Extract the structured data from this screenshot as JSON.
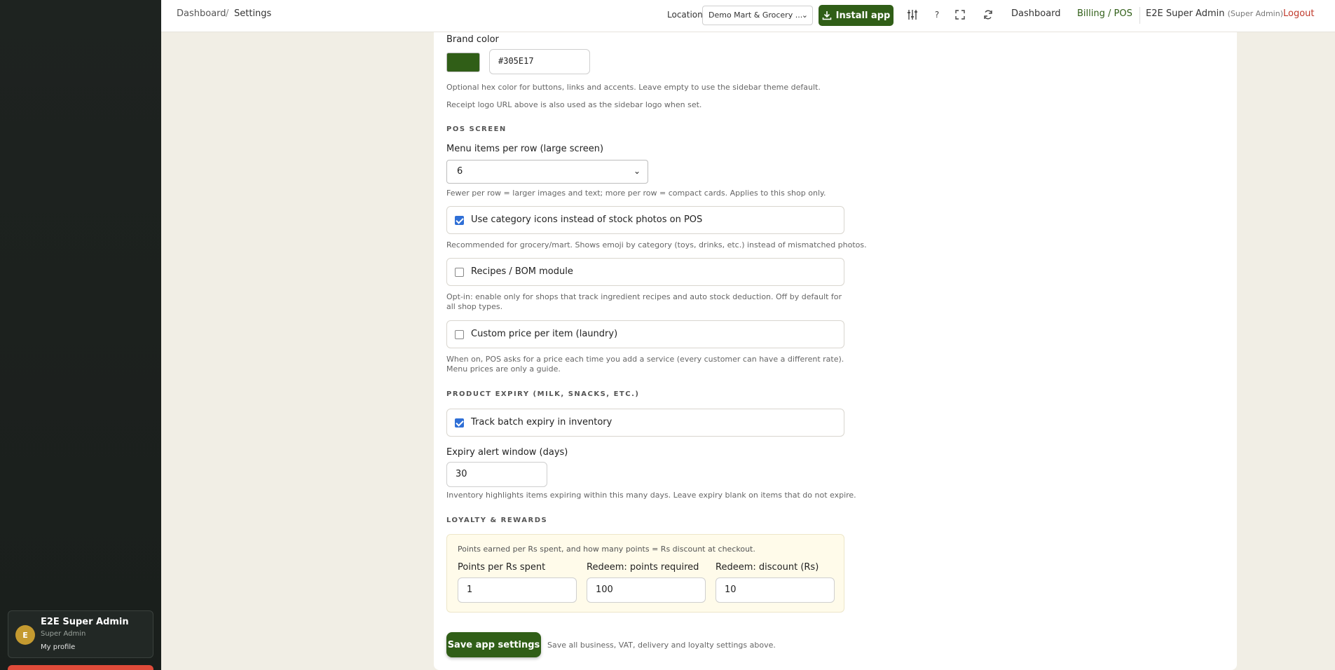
{
  "breadcrumb": {
    "root": "Dashboard",
    "separator": "/",
    "current": "Settings"
  },
  "topbar": {
    "location_label": "Location",
    "location_value": "Demo Mart & Grocery ...",
    "install_label": "Install app",
    "help_label": "?",
    "dashboard_label": "Dashboard",
    "billing_label": "Billing / POS",
    "admin_name": "E2E Super Admin",
    "admin_role": "(Super Admin)",
    "logout_label": "Logout"
  },
  "sidebar": {
    "profile_initial": "E",
    "profile_name": "E2E Super Admin",
    "profile_role": "Super Admin",
    "profile_link": "My profile"
  },
  "branding": {
    "brand_color_label": "Brand color",
    "brand_color_value": "#305E17",
    "brand_color_help": "Optional hex color for buttons, links and accents. Leave empty to use the sidebar theme default.",
    "logo_help": "Receipt logo URL above is also used as the sidebar logo when set."
  },
  "pos_screen": {
    "section_title": "POS SCREEN",
    "menu_items_label": "Menu items per row (large screen)",
    "menu_items_value": "6",
    "menu_items_help": "Fewer per row = larger images and text; more per row = compact cards. Applies to this shop only.",
    "category_icons_label": "Use category icons instead of stock photos on POS",
    "category_icons_checked": true,
    "category_icons_help": "Recommended for grocery/mart. Shows emoji by category (toys, drinks, etc.) instead of mismatched photos.",
    "recipes_label": "Recipes / BOM module",
    "recipes_checked": false,
    "recipes_help": "Opt-in: enable only for shops that track ingredient recipes and auto stock deduction. Off by default for all shop types.",
    "custom_price_label": "Custom price per item (laundry)",
    "custom_price_checked": false,
    "custom_price_help": "When on, POS asks for a price each time you add a service (every customer can have a different rate). Menu prices are only a guide."
  },
  "expiry": {
    "section_title": "PRODUCT EXPIRY (MILK, SNACKS, ETC.)",
    "track_label": "Track batch expiry in inventory",
    "track_checked": true,
    "window_label": "Expiry alert window (days)",
    "window_value": "30",
    "window_help": "Inventory highlights items expiring within this many days. Leave expiry blank on items that do not expire."
  },
  "loyalty": {
    "section_title": "LOYALTY & REWARDS",
    "intro": "Points earned per Rs spent, and how many points = Rs discount at checkout.",
    "points_label": "Points per Rs spent",
    "points_value": "1",
    "redeem_points_label": "Redeem: points required",
    "redeem_points_value": "100",
    "redeem_discount_label": "Redeem: discount (Rs)",
    "redeem_discount_value": "10"
  },
  "footer": {
    "save_label": "Save app settings",
    "save_help": "Save all business, VAT, delivery and loyalty settings above."
  }
}
